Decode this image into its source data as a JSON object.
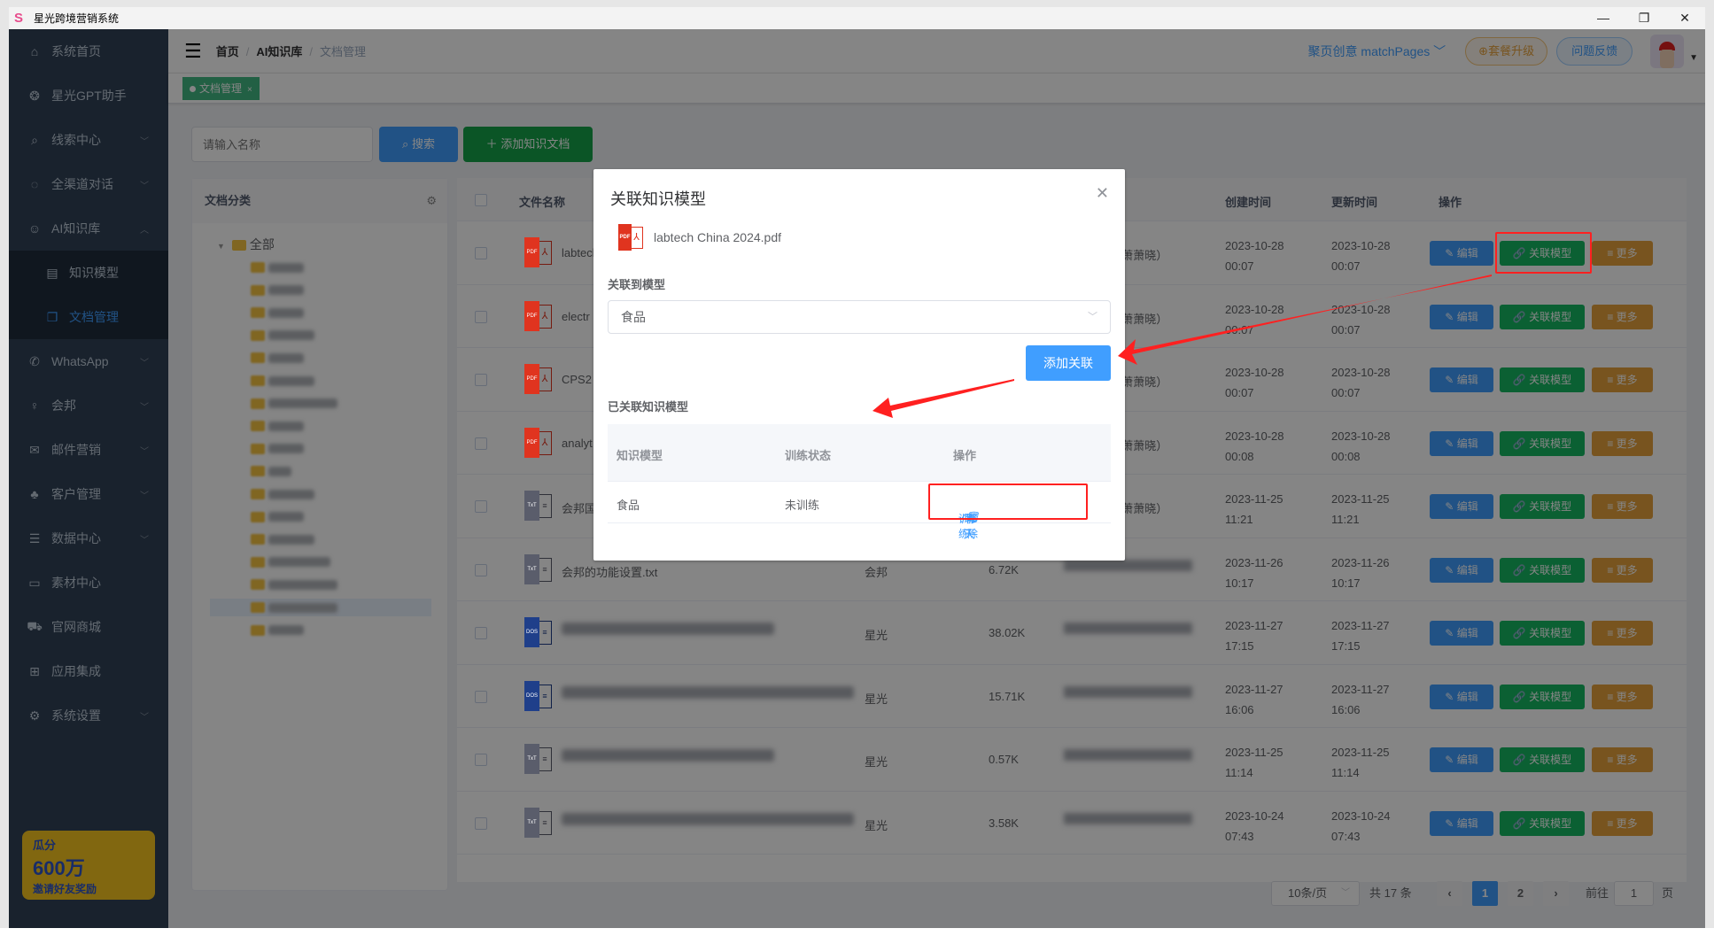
{
  "window": {
    "title": "星光跨境营销系统",
    "controls": [
      "minimize",
      "restore",
      "close"
    ]
  },
  "sidebar": {
    "items": [
      {
        "label": "系统首页",
        "icon": "home-icon",
        "chevron": false
      },
      {
        "label": "星光GPT助手",
        "icon": "openai-icon",
        "chevron": false
      },
      {
        "label": "线索中心",
        "icon": "search-doc-icon",
        "chevron": true
      },
      {
        "label": "全渠道对话",
        "icon": "chat-icon",
        "chevron": true
      },
      {
        "label": "AI知识库",
        "icon": "brain-icon",
        "chevron": true,
        "expanded": true
      },
      {
        "label": "知识模型",
        "icon": "inbox-icon",
        "sub": true
      },
      {
        "label": "文档管理",
        "icon": "copy-icon",
        "sub": true,
        "active": true
      },
      {
        "label": "WhatsApp",
        "icon": "whatsapp-icon",
        "chevron": true
      },
      {
        "label": "会邦",
        "icon": "bulb-icon",
        "chevron": true
      },
      {
        "label": "邮件营销",
        "icon": "mail-icon",
        "chevron": true
      },
      {
        "label": "客户管理",
        "icon": "users-icon",
        "chevron": true
      },
      {
        "label": "数据中心",
        "icon": "database-icon",
        "chevron": true
      },
      {
        "label": "素材中心",
        "icon": "folder-icon",
        "chevron": false
      },
      {
        "label": "官网商城",
        "icon": "cart-icon",
        "chevron": false
      },
      {
        "label": "应用集成",
        "icon": "grid-icon",
        "chevron": false
      },
      {
        "label": "系统设置",
        "icon": "gear-icon",
        "chevron": true
      }
    ],
    "promo": {
      "line1": "瓜分",
      "line2": "600万",
      "line3": "邀请好友奖励"
    }
  },
  "header": {
    "breadcrumb": [
      "首页",
      "AI知识库",
      "文档管理"
    ],
    "org": "聚页创意 matchPages",
    "upgrade": "套餐升级",
    "feedback": "问题反馈"
  },
  "tags": [
    {
      "label": "文档管理",
      "close": "×"
    }
  ],
  "toolbar": {
    "search_placeholder": "请输入名称",
    "search_label": "搜索",
    "add_label": "添加知识文档"
  },
  "category_panel": {
    "title": "文档分类",
    "root": "全部"
  },
  "table": {
    "headers": {
      "name": "文件名称",
      "created": "创建时间",
      "updated": "更新时间",
      "actions": "操作"
    },
    "action_labels": {
      "edit": "编辑",
      "link": "关联模型",
      "more": "更多"
    },
    "rows": [
      {
        "type": "pdf",
        "name": "labtech China 2024.pdf",
        "category": "",
        "size": "",
        "creator": "5（萧萧晓）",
        "created": [
          "2023-10-28",
          "00:07"
        ],
        "updated": [
          "2023-10-28",
          "00:07"
        ]
      },
      {
        "type": "pdf",
        "name": "electr",
        "category": "",
        "size": "",
        "creator": "5（萧萧晓）",
        "created": [
          "2023-10-28",
          "00:07"
        ],
        "updated": [
          "2023-10-28",
          "00:07"
        ]
      },
      {
        "type": "pdf",
        "name": "CPS2",
        "category": "",
        "size": "",
        "creator": "5（萧萧晓）",
        "created": [
          "2023-10-28",
          "00:07"
        ],
        "updated": [
          "2023-10-28",
          "00:07"
        ]
      },
      {
        "type": "pdf",
        "name": "analyt",
        "category": "",
        "size": "",
        "creator": "5（萧萧晓）",
        "created": [
          "2023-10-28",
          "00:08"
        ],
        "updated": [
          "2023-10-28",
          "00:08"
        ]
      },
      {
        "type": "txt",
        "name": "会邦国",
        "category": "",
        "size": "",
        "creator": "5（萧萧晓）",
        "created": [
          "2023-11-25",
          "11:21"
        ],
        "updated": [
          "2023-11-25",
          "11:21"
        ]
      },
      {
        "type": "txt",
        "name": "会邦的功能设置.txt",
        "category": "会邦",
        "size": "6.72K",
        "creator": "",
        "created": [
          "2023-11-26",
          "10:17"
        ],
        "updated": [
          "2023-11-26",
          "10:17"
        ]
      },
      {
        "type": "doc",
        "name": "",
        "category": "星光",
        "size": "38.02K",
        "creator": "",
        "created": [
          "2023-11-27",
          "17:15"
        ],
        "updated": [
          "2023-11-27",
          "17:15"
        ]
      },
      {
        "type": "doc",
        "name": "",
        "category": "星光",
        "size": "15.71K",
        "creator": "",
        "created": [
          "2023-11-27",
          "16:06"
        ],
        "updated": [
          "2023-11-27",
          "16:06"
        ]
      },
      {
        "type": "txt",
        "name": "",
        "category": "星光",
        "size": "0.57K",
        "creator": "",
        "created": [
          "2023-11-25",
          "11:14"
        ],
        "updated": [
          "2023-11-25",
          "11:14"
        ]
      },
      {
        "type": "txt",
        "name": "",
        "category": "星光",
        "size": "3.58K",
        "creator": "",
        "created": [
          "2023-10-24",
          "07:43"
        ],
        "updated": [
          "2023-10-24",
          "07:43"
        ]
      }
    ]
  },
  "pagination": {
    "page_size": "10条/页",
    "total": "共 17 条",
    "pages": [
      "1",
      "2"
    ],
    "current": "1",
    "goto_label": "前往",
    "goto_value": "1",
    "goto_suffix": "页"
  },
  "modal": {
    "title": "关联知识模型",
    "file": "labtech China 2024.pdf",
    "link_to_label": "关联到模型",
    "selected_model": "食品",
    "add_button": "添加关联",
    "linked_title": "已关联知识模型",
    "linked_headers": [
      "知识模型",
      "训练状态",
      "操作"
    ],
    "linked_rows": [
      {
        "model": "食品",
        "status": "未训练",
        "ops": [
          "训练",
          "聊天",
          "移除"
        ]
      }
    ]
  },
  "colors": {
    "primary": "#409eff",
    "success": "#16b862",
    "warning": "#e6a23c",
    "sidebar": "#304156",
    "annotation": "#ff2020"
  }
}
